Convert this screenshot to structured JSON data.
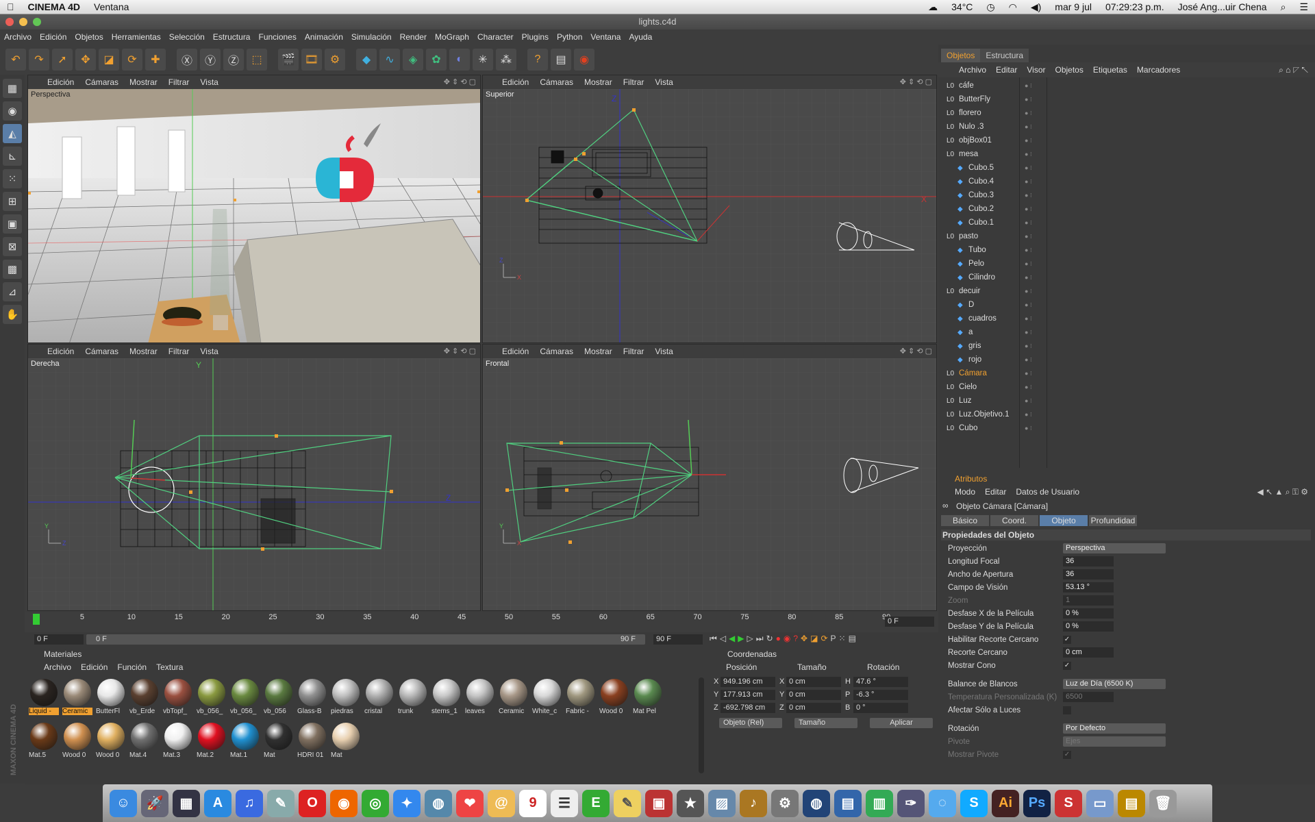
{
  "mac_menubar": {
    "app": "CINEMA 4D",
    "menu": "Ventana",
    "temperature": "34°C",
    "date": "mar 9 jul",
    "time": "07:29:23 p.m.",
    "user": "José Ang...uir Chena"
  },
  "window": {
    "title": "lights.c4d"
  },
  "app_menu": [
    "Archivo",
    "Edición",
    "Objetos",
    "Herramientas",
    "Selección",
    "Estructura",
    "Funciones",
    "Animación",
    "Simulación",
    "Render",
    "MoGraph",
    "Character",
    "Plugins",
    "Python",
    "Ventana",
    "Ayuda"
  ],
  "viewports": [
    {
      "name": "Perspectiva",
      "menu": [
        "Edición",
        "Cámaras",
        "Mostrar",
        "Filtrar",
        "Vista"
      ]
    },
    {
      "name": "Superior",
      "menu": [
        "Edición",
        "Cámaras",
        "Mostrar",
        "Filtrar",
        "Vista"
      ]
    },
    {
      "name": "Derecha",
      "menu": [
        "Edición",
        "Cámaras",
        "Mostrar",
        "Filtrar",
        "Vista"
      ]
    },
    {
      "name": "Frontal",
      "menu": [
        "Edición",
        "Cámaras",
        "Mostrar",
        "Filtrar",
        "Vista"
      ]
    }
  ],
  "objects_panel": {
    "tabs": [
      "Objetos",
      "Estructura"
    ],
    "menu": [
      "Archivo",
      "Editar",
      "Visor",
      "Objetos",
      "Etiquetas",
      "Marcadores"
    ],
    "items": [
      {
        "name": "cáfe",
        "level": 0
      },
      {
        "name": "ButterFly",
        "level": 0
      },
      {
        "name": "florero",
        "level": 0
      },
      {
        "name": "Nulo .3",
        "level": 0
      },
      {
        "name": "objBox01",
        "level": 0
      },
      {
        "name": "mesa",
        "level": 0
      },
      {
        "name": "Cubo.5",
        "level": 1
      },
      {
        "name": "Cubo.4",
        "level": 1
      },
      {
        "name": "Cubo.3",
        "level": 1
      },
      {
        "name": "Cubo.2",
        "level": 1
      },
      {
        "name": "Cubo.1",
        "level": 1
      },
      {
        "name": "pasto",
        "level": 0
      },
      {
        "name": "Tubo",
        "level": 1
      },
      {
        "name": "Pelo",
        "level": 1
      },
      {
        "name": "Cilindro",
        "level": 1
      },
      {
        "name": "decuir",
        "level": 0
      },
      {
        "name": "D",
        "level": 1
      },
      {
        "name": "cuadros",
        "level": 1
      },
      {
        "name": "a",
        "level": 1
      },
      {
        "name": "gris",
        "level": 1
      },
      {
        "name": "rojo",
        "level": 1
      },
      {
        "name": "Cámara",
        "level": 0,
        "selected": true
      },
      {
        "name": "Cielo",
        "level": 0
      },
      {
        "name": "Luz",
        "level": 0
      },
      {
        "name": "Luz.Objetivo.1",
        "level": 0
      },
      {
        "name": "Cubo",
        "level": 0
      }
    ]
  },
  "attributes_panel": {
    "title": "Atributos",
    "menu": [
      "Modo",
      "Editar",
      "Datos de Usuario"
    ],
    "object_title": "Objeto Cámara [Cámara]",
    "tabs": [
      "Básico",
      "Coord.",
      "Objeto",
      "Profundidad"
    ],
    "active_tab": "Objeto",
    "section": "Propiedades del Objeto",
    "rows": [
      {
        "label": "Proyección",
        "value": "Perspectiva",
        "type": "dropdown"
      },
      {
        "label": "Longitud Focal",
        "value": "36",
        "type": "field"
      },
      {
        "label": "Ancho de Apertura",
        "value": "36",
        "type": "field"
      },
      {
        "label": "Campo de Visión",
        "value": "53.13 °",
        "type": "field"
      },
      {
        "label": "Zoom",
        "value": "1",
        "type": "field",
        "dim": true
      },
      {
        "label": "Desfase X de la Película",
        "value": "0 %",
        "type": "field"
      },
      {
        "label": "Desfase Y de la Película",
        "value": "0 %",
        "type": "field"
      },
      {
        "label": "Habilitar Recorte Cercano",
        "value": "✓",
        "type": "check"
      },
      {
        "label": "Recorte Cercano",
        "value": "0 cm",
        "type": "field"
      },
      {
        "label": "Mostrar Cono",
        "value": "✓",
        "type": "check"
      },
      {
        "label": "",
        "value": "",
        "type": "gap"
      },
      {
        "label": "Balance de Blancos",
        "value": "Luz de Día (6500 K)",
        "type": "dropdown"
      },
      {
        "label": "Temperatura Personalizada (K)",
        "value": "6500",
        "type": "field",
        "dim": true
      },
      {
        "label": "Afectar Sólo a Luces",
        "value": "",
        "type": "check"
      },
      {
        "label": "",
        "value": "",
        "type": "gap"
      },
      {
        "label": "Rotación",
        "value": "Por Defecto",
        "type": "dropdown"
      },
      {
        "label": "Pivote",
        "value": "Ejes",
        "type": "dropdown",
        "dim": true
      },
      {
        "label": "Mostrar Pivote",
        "value": "✓",
        "type": "check",
        "dim": true
      }
    ]
  },
  "timeline": {
    "ticks": [
      "0",
      "5",
      "10",
      "15",
      "20",
      "25",
      "30",
      "35",
      "40",
      "45",
      "50",
      "55",
      "60",
      "65",
      "70",
      "75",
      "80",
      "85",
      "90"
    ],
    "current": "0 F",
    "start": "0 F",
    "range_start": "0 F",
    "range_end": "90 F",
    "end": "90 F"
  },
  "materials_panel": {
    "title": "Materiales",
    "menu": [
      "Archivo",
      "Edición",
      "Función",
      "Textura"
    ],
    "row1": [
      {
        "name": "Liquid -",
        "color": "#2a2420",
        "sel": true
      },
      {
        "name": "Ceramic",
        "color": "#9a8a78",
        "sel": true
      },
      {
        "name": "ButterFl",
        "color": "#e8e8e8"
      },
      {
        "name": "vb_Erde",
        "color": "#5a4030"
      },
      {
        "name": "vbTopf_",
        "color": "#9a5040"
      },
      {
        "name": "vb_056_",
        "color": "#8a9a40"
      },
      {
        "name": "vb_056_",
        "color": "#6a8a40"
      },
      {
        "name": "vb_056",
        "color": "#5a7a40"
      },
      {
        "name": "Glass-B",
        "color": "#909090"
      },
      {
        "name": "piedras",
        "color": "#c0c0c0"
      },
      {
        "name": "cristal",
        "color": "#b0b0b0"
      },
      {
        "name": "trunk",
        "color": "#b8b8b8"
      },
      {
        "name": "stems_1",
        "color": "#c8c8c8"
      },
      {
        "name": "leaves",
        "color": "#c4c4c4"
      },
      {
        "name": "Ceramic",
        "color": "#a89888"
      },
      {
        "name": "White_c",
        "color": "#d8d8d8"
      },
      {
        "name": "Fabric -",
        "color": "#a09880"
      },
      {
        "name": "Wood 0",
        "color": "#8a4020"
      },
      {
        "name": "Mat Pel",
        "color": "#5a8a50"
      }
    ],
    "row2": [
      {
        "name": "Mat.5",
        "color": "#6a3a18"
      },
      {
        "name": "Wood 0",
        "color": "#d09050"
      },
      {
        "name": "Wood 0",
        "color": "#e0b060"
      },
      {
        "name": "Mat.4",
        "color": "#707070"
      },
      {
        "name": "Mat.3",
        "color": "#f0f0f0"
      },
      {
        "name": "Mat.2",
        "color": "#e01020"
      },
      {
        "name": "Mat.1",
        "color": "#2090d0"
      },
      {
        "name": "Mat",
        "color": "#303030"
      },
      {
        "name": "HDRI 01",
        "color": "#807060"
      },
      {
        "name": "Mat",
        "color": "#e8d0b0"
      }
    ]
  },
  "coords_panel": {
    "title": "Coordenadas",
    "headers": [
      "Posición",
      "Tamaño",
      "Rotación"
    ],
    "rows": [
      {
        "axis": "X",
        "pos": "949.196 cm",
        "size_axis": "X",
        "size": "0 cm",
        "rot_axis": "H",
        "rot": "47.6 °"
      },
      {
        "axis": "Y",
        "pos": "177.913 cm",
        "size_axis": "Y",
        "size": "0 cm",
        "rot_axis": "P",
        "rot": "-6.3 °"
      },
      {
        "axis": "Z",
        "pos": "-692.798 cm",
        "size_axis": "Z",
        "size": "0 cm",
        "rot_axis": "B",
        "rot": "0 °"
      }
    ],
    "mode": "Objeto (Rel)",
    "size_mode": "Tamaño",
    "apply": "Aplicar"
  },
  "brand": "MAXON CINEMA 4D",
  "colors": {
    "accent": "#f0a030",
    "selected_tab": "#5a7ea8",
    "camera_green": "#50d080"
  }
}
